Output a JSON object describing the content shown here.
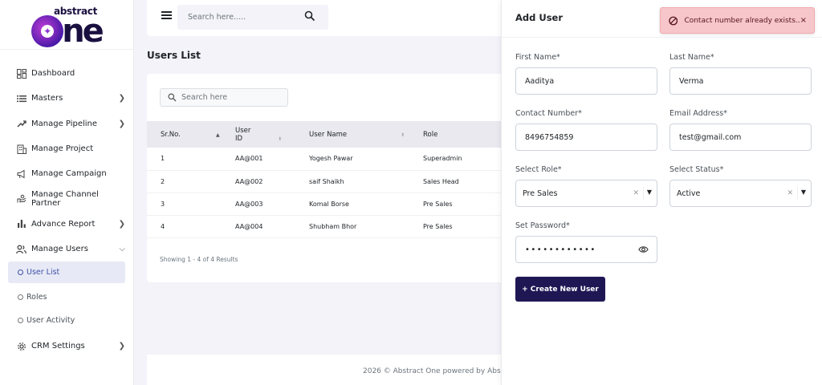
{
  "logo": {
    "top": "abstract",
    "o_letter": "✦",
    "rest": "ne"
  },
  "sidebar": {
    "items": [
      {
        "label": "Dashboard",
        "icon": "dashboard-grid-icon"
      },
      {
        "label": "Masters",
        "icon": "list-icon"
      },
      {
        "label": "Manage Pipeline",
        "icon": "pipeline-icon"
      },
      {
        "label": "Manage Project",
        "icon": "building-icon"
      },
      {
        "label": "Manage Campaign",
        "icon": "megaphone-icon"
      },
      {
        "label": "Manage Channel Partner",
        "icon": "handshake-icon"
      },
      {
        "label": "Advance Report",
        "icon": "bar-chart-icon"
      },
      {
        "label": "Manage Users",
        "icon": "users-icon"
      }
    ],
    "sub_items": [
      {
        "label": "User List"
      },
      {
        "label": "Roles"
      },
      {
        "label": "User Activity"
      }
    ],
    "settings": {
      "label": "CRM Settings",
      "icon": "gear-icon"
    }
  },
  "topbar": {
    "search_placeholder": "Search here....."
  },
  "users": {
    "title": "Users List",
    "search_placeholder": "Search here",
    "columns": [
      "Sr.No.",
      "User ID",
      "User Name",
      "Role"
    ],
    "rows": [
      [
        "1",
        "AA@001",
        "Yogesh Pawar",
        "Superadmin"
      ],
      [
        "2",
        "AA@002",
        "saif Shaikh",
        "Sales Head"
      ],
      [
        "3",
        "AA@003",
        "Komal Borse",
        "Pre Sales"
      ],
      [
        "4",
        "AA@004",
        "Shubham Bhor",
        "Pre Sales"
      ]
    ],
    "showing": "Showing 1 - 4 of 4 Results"
  },
  "footer": {
    "text": "2026 © Abstract One powered by Abst"
  },
  "add_user": {
    "title": "Add User",
    "first_name": {
      "label": "First Name*",
      "value": "Aaditya"
    },
    "last_name": {
      "label": "Last Name*",
      "value": "Verma"
    },
    "contact": {
      "label": "Contact Number*",
      "value": "8496754859"
    },
    "email": {
      "label": "Email Address*",
      "value": "test@gmail.com"
    },
    "role": {
      "label": "Select Role*",
      "value": "Pre Sales"
    },
    "status": {
      "label": "Select Status*",
      "value": "Active"
    },
    "password": {
      "label": "Set Password*",
      "value": "••••••••••••"
    },
    "submit": "+ Create New User"
  },
  "toast": {
    "message": "Contact number already exists..",
    "close": "×"
  },
  "colors": {
    "accent": "#1f1754",
    "active_nav": "#3f4fa6",
    "toast_bg": "#f6c6ca"
  }
}
